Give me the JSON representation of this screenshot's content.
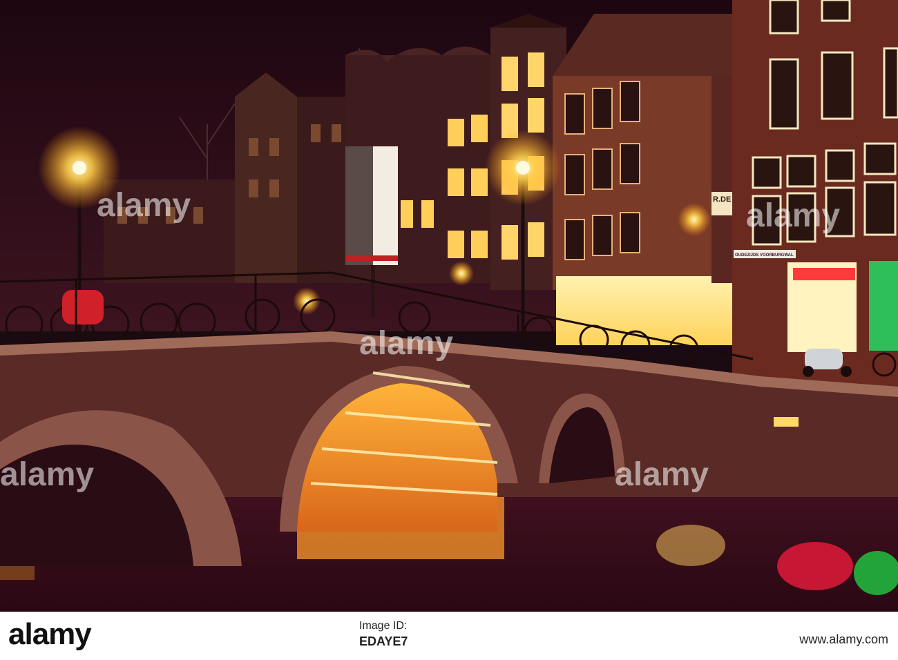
{
  "scene": {
    "sky_color": "#2a0b18",
    "water_color": "#3a0f1f",
    "light_color": "#ffb020",
    "building_sign": "R.DE",
    "street_sign": "OUDEZIJDS VOORBURGWAL"
  },
  "watermark": {
    "text": "alamy"
  },
  "footer": {
    "brand": "alamy",
    "id_label": "Image ID:",
    "id_value": "EDAYE7",
    "url": "www.alamy.com"
  }
}
